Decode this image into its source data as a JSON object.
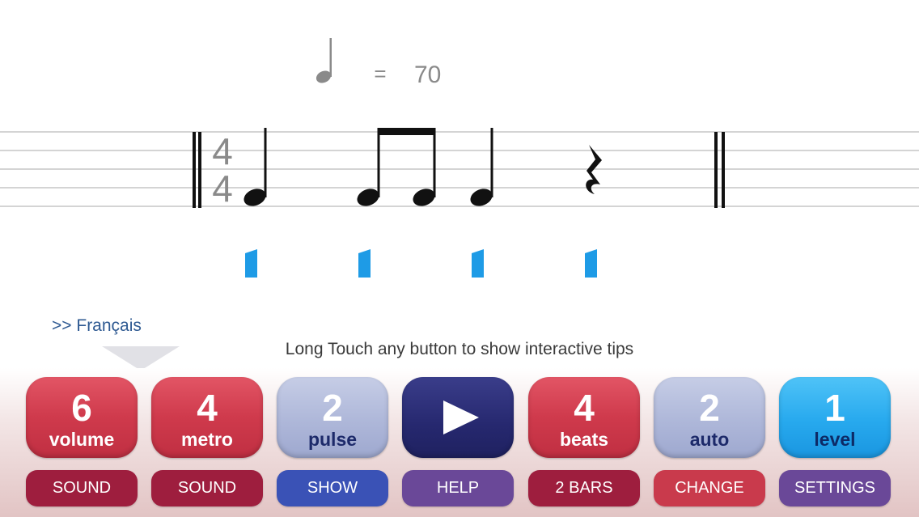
{
  "tempo": {
    "note": "quarter-note-icon",
    "equals": "=",
    "bpm": "70"
  },
  "staff": {
    "time_signature": {
      "top": "4",
      "bottom": "4"
    },
    "notes": [
      "quarter-note",
      "eighth-note",
      "eighth-note",
      "quarter-note",
      "quarter-rest"
    ],
    "pulse_marker_color": "#1e9be6"
  },
  "language_link": ">> Français",
  "tip_text": "Long Touch any button to show interactive tips",
  "buttons": [
    {
      "value": "6",
      "label": "volume",
      "sub": "SOUND"
    },
    {
      "value": "4",
      "label": "metro",
      "sub": "SOUND"
    },
    {
      "value": "2",
      "label": "pulse",
      "sub": "SHOW"
    },
    {
      "icon": "play-icon",
      "sub": "HELP"
    },
    {
      "value": "4",
      "label": "beats",
      "sub": "2 BARS"
    },
    {
      "value": "2",
      "label": "auto",
      "sub": "CHANGE"
    },
    {
      "value": "1",
      "label": "level",
      "sub": "SETTINGS"
    }
  ],
  "colors": {
    "red": "#cf3a4c",
    "lavender": "#aeb7d9",
    "navy": "#26286f",
    "sky": "#27a9ee",
    "maroon": "#9e1e3e",
    "blue": "#3a52b6",
    "purple": "#6a4898"
  }
}
